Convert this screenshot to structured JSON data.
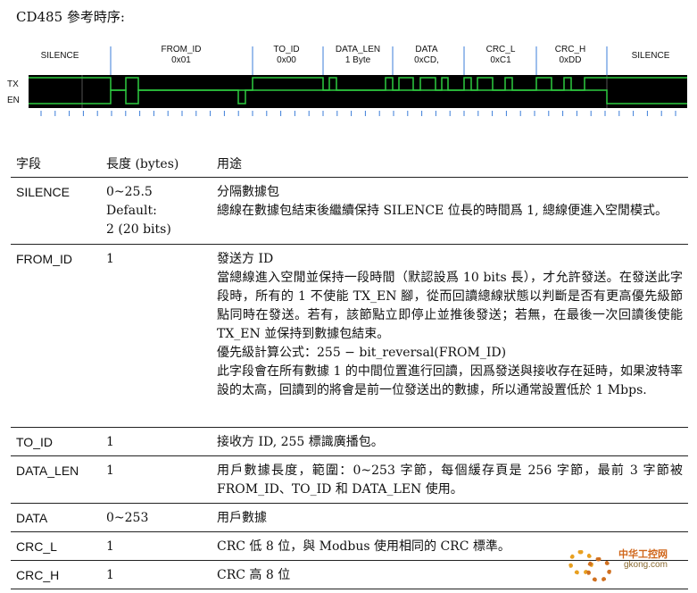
{
  "title": "CD485 參考時序:",
  "timing": {
    "segments": [
      {
        "line1": "SILENCE",
        "line2": ""
      },
      {
        "line1": "FROM_ID",
        "line2": "0x01"
      },
      {
        "line1": "TO_ID",
        "line2": "0x00"
      },
      {
        "line1": "DATA_LEN",
        "line2": "1 Byte"
      },
      {
        "line1": "DATA",
        "line2": "0xCD,"
      },
      {
        "line1": "CRC_L",
        "line2": "0xC1"
      },
      {
        "line1": "CRC_H",
        "line2": "0xDD"
      },
      {
        "line1": "SILENCE",
        "line2": ""
      }
    ],
    "signals": [
      "TX",
      "EN"
    ],
    "colors": {
      "signal": "#2ecc40",
      "background": "#000000",
      "divider": "#3b7dd8"
    }
  },
  "table": {
    "headers": [
      "字段",
      "長度 (bytes)",
      "用途"
    ],
    "rows": [
      {
        "field": "SILENCE",
        "length": [
          "0~25.5",
          "Default:",
          "2 (20 bits)"
        ],
        "usage": [
          "分隔數據包",
          "總線在數據包結束後繼續保持 SILENCE 位長的時間爲 1, 總線便進入空閒模式。"
        ]
      },
      {
        "field": "FROM_ID",
        "length": [
          "1"
        ],
        "usage": [
          "發送方 ID",
          "當總線進入空閒並保持一段時間（默認設爲 10 bits 長），才允許發送。在發送此字段時，所有的 1 不使能 TX_EN 腳，從而回讀總線狀態以判斷是否有更高優先級節點同時在發送。若有，該節點立即停止並推後發送；若無，在最後一次回讀後使能 TX_EN 並保持到數據包結束。",
          "優先級計算公式：255 − bit_reversal(FROM_ID)",
          "此字段會在所有數據 1 的中間位置進行回讀，因爲發送與接收存在延時，如果波特率設的太高，回讀到的將會是前一位發送出的數據，所以通常設置低於 1 Mbps."
        ]
      },
      {
        "field": "TO_ID",
        "length": [
          "1"
        ],
        "usage": [
          "接收方 ID, 255 標識廣播包。"
        ]
      },
      {
        "field": "DATA_LEN",
        "length": [
          "1"
        ],
        "usage": [
          "用戶數據長度，範圍：0~253 字節，每個緩存頁是 256 字節，最前 3 字節被 FROM_ID、TO_ID 和 DATA_LEN 使用。"
        ]
      },
      {
        "field": "DATA",
        "length": [
          "0~253"
        ],
        "usage": [
          "用戶數據"
        ]
      },
      {
        "field": "CRC_L",
        "length": [
          "1"
        ],
        "usage": [
          "CRC 低 8 位，與 Modbus 使用相同的 CRC 標準。"
        ]
      },
      {
        "field": "CRC_H",
        "length": [
          "1"
        ],
        "usage": [
          "CRC 高 8 位"
        ]
      }
    ]
  },
  "watermark": {
    "brand": "中华工控网",
    "url": "gkong.com"
  }
}
